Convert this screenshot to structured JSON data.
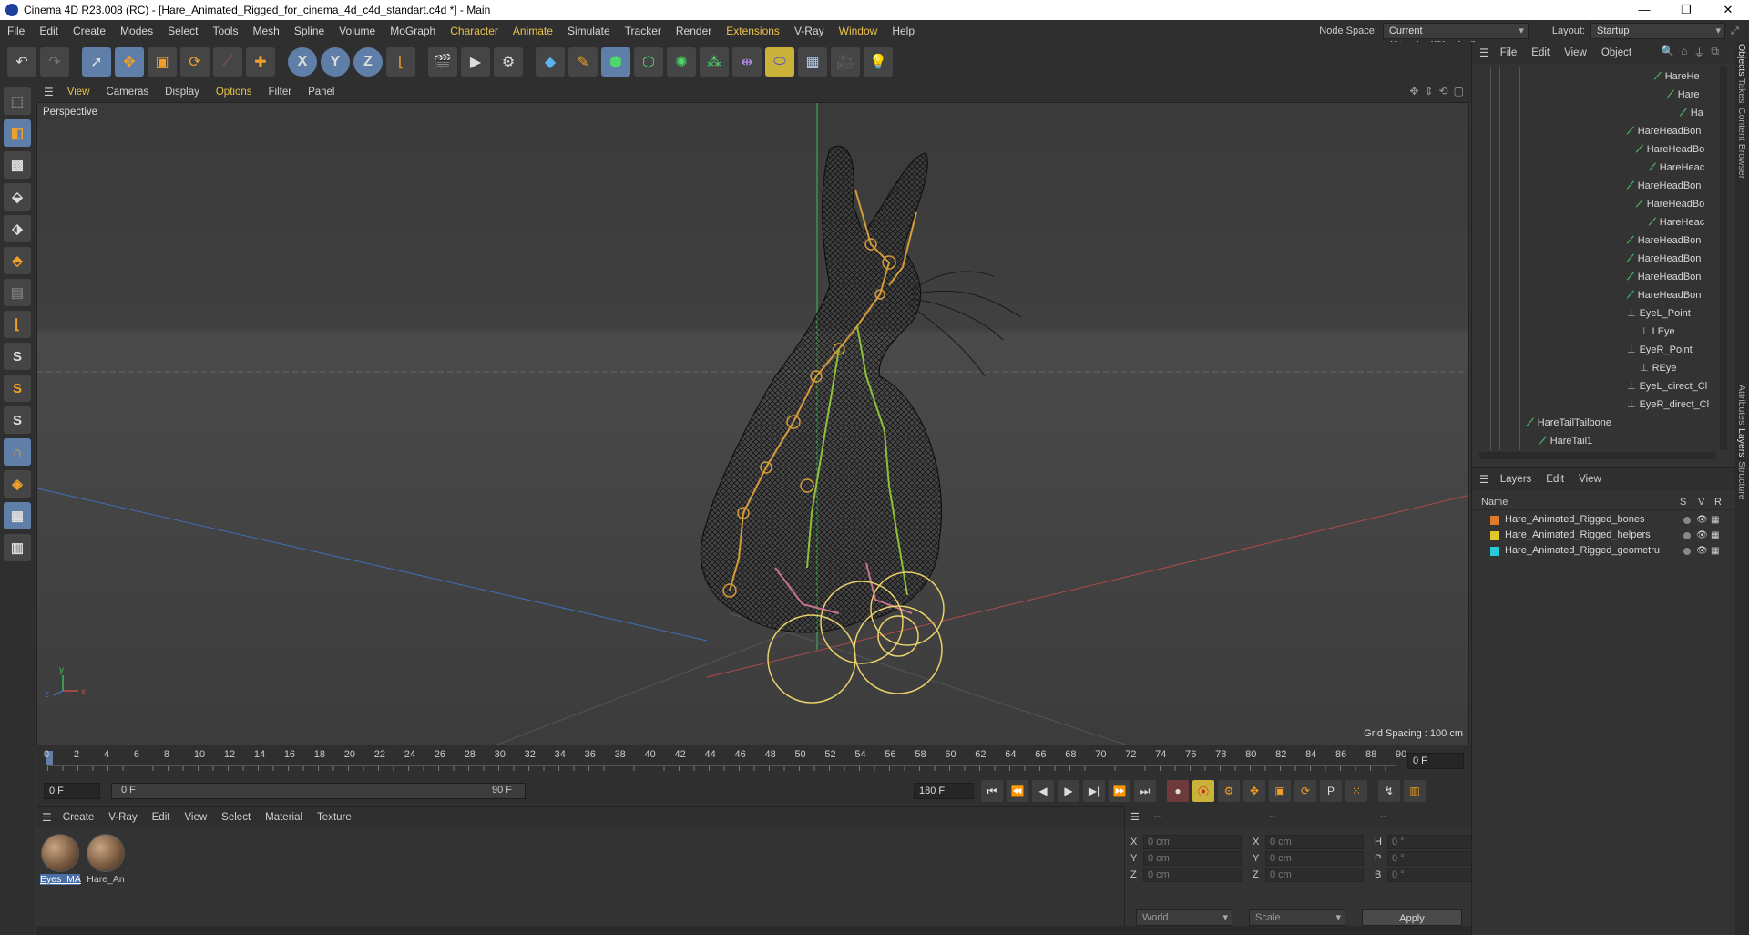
{
  "window": {
    "title": "Cinema 4D R23.008 (RC) - [Hare_Animated_Rigged_for_cinema_4d_c4d_standart.c4d *] - Main"
  },
  "menubar": {
    "items": [
      "File",
      "Edit",
      "Create",
      "Modes",
      "Select",
      "Tools",
      "Mesh",
      "Spline",
      "Volume",
      "MoGraph",
      "Character",
      "Animate",
      "Simulate",
      "Tracker",
      "Render",
      "Extensions",
      "V-Ray",
      "Window",
      "Help"
    ],
    "node_space_label": "Node Space:",
    "node_space_value": "Current (Standard/Physical)",
    "layout_label": "Layout:",
    "layout_value": "Startup"
  },
  "toolbar": {
    "icons": [
      "undo-icon",
      "redo-icon",
      "live-select-icon",
      "move-icon",
      "scale-icon",
      "rotate-icon",
      "recent-tool-icon",
      "transform-icon",
      "x-axis-icon",
      "y-axis-icon",
      "z-axis-icon",
      "coordinate-system-icon",
      "render-view-icon",
      "render-picture-viewer-icon",
      "render-settings-icon",
      "cube-icon",
      "pen-icon",
      "subdivision-icon",
      "extrude-icon",
      "cloner-icon",
      "array-icon",
      "symmetry-icon",
      "deformer-icon",
      "floor-icon",
      "camera-icon",
      "light-icon"
    ],
    "axis_labels": [
      "X",
      "Y",
      "Z"
    ]
  },
  "viewport": {
    "menu": [
      "View",
      "Cameras",
      "Display",
      "Options",
      "Filter",
      "Panel"
    ],
    "label": "Perspective",
    "grid_spacing": "Grid Spacing : 100 cm"
  },
  "timeline": {
    "ticks": [
      "0",
      "2",
      "4",
      "6",
      "8",
      "10",
      "12",
      "14",
      "16",
      "18",
      "20",
      "22",
      "24",
      "26",
      "28",
      "30",
      "32",
      "34",
      "36",
      "38",
      "40",
      "42",
      "44",
      "46",
      "48",
      "50",
      "52",
      "54",
      "56",
      "58",
      "60",
      "62",
      "64",
      "66",
      "68",
      "70",
      "72",
      "74",
      "76",
      "78",
      "80",
      "82",
      "84",
      "86",
      "88",
      "90"
    ],
    "current_frame_right": "0 F",
    "start_frame": "0 F",
    "range_start": "0 F",
    "range_end": "90 F",
    "end_frame": "180 F",
    "playhead_fraction": 0.0
  },
  "materials": {
    "menu": [
      "Create",
      "V-Ray",
      "Edit",
      "View",
      "Select",
      "Material",
      "Texture"
    ],
    "items": [
      {
        "label": "Eyes_MA",
        "selected": true
      },
      {
        "label": "Hare_An",
        "selected": false
      }
    ]
  },
  "coordinates": {
    "header": [
      "--",
      "--",
      "--"
    ],
    "rows": [
      {
        "a": "X",
        "v1": "0 cm",
        "b": "X",
        "v2": "0 cm",
        "c": "H",
        "v3": "0 °"
      },
      {
        "a": "Y",
        "v1": "0 cm",
        "b": "Y",
        "v2": "0 cm",
        "c": "P",
        "v3": "0 °"
      },
      {
        "a": "Z",
        "v1": "0 cm",
        "b": "Z",
        "v2": "0 cm",
        "c": "B",
        "v3": "0 °"
      }
    ],
    "mode": "World",
    "scale": "Scale",
    "apply": "Apply"
  },
  "objects": {
    "menu": [
      "File",
      "Edit",
      "View",
      "Object"
    ],
    "items": [
      {
        "label": "HareHe",
        "type": "bone",
        "indent": 200
      },
      {
        "label": "Hare",
        "type": "bone",
        "indent": 214
      },
      {
        "label": "Ha",
        "type": "bone",
        "indent": 228
      },
      {
        "label": "HareHeadBon",
        "type": "bone",
        "indent": 170
      },
      {
        "label": "HareHeadBo",
        "type": "bone",
        "indent": 180
      },
      {
        "label": "HareHeac",
        "type": "bone",
        "indent": 194
      },
      {
        "label": "HareHeadBon",
        "type": "bone",
        "indent": 170
      },
      {
        "label": "HareHeadBo",
        "type": "bone",
        "indent": 180
      },
      {
        "label": "HareHeac",
        "type": "bone",
        "indent": 194
      },
      {
        "label": "HareHeadBon",
        "type": "bone",
        "indent": 170
      },
      {
        "label": "HareHeadBon",
        "type": "bone",
        "indent": 170
      },
      {
        "label": "HareHeadBon",
        "type": "bone",
        "indent": 170
      },
      {
        "label": "HareHeadBon",
        "type": "bone",
        "indent": 170
      },
      {
        "label": "EyeL_Point",
        "type": "null",
        "indent": 170
      },
      {
        "label": "LEye",
        "type": "null",
        "indent": 184
      },
      {
        "label": "EyeR_Point",
        "type": "null",
        "indent": 170
      },
      {
        "label": "REye",
        "type": "null",
        "indent": 184
      },
      {
        "label": "EyeL_direct_Cl",
        "type": "null",
        "indent": 170
      },
      {
        "label": "EyeR_direct_Cl",
        "type": "null",
        "indent": 170
      },
      {
        "label": "HareTailTailbone",
        "type": "bone",
        "indent": 60
      },
      {
        "label": "HareTail1",
        "type": "bone",
        "indent": 74
      }
    ]
  },
  "layers": {
    "menu": [
      "Layers",
      "Edit",
      "View"
    ],
    "columns": [
      "Name",
      "S",
      "V",
      "R"
    ],
    "items": [
      {
        "label": "Hare_Animated_Rigged_bones",
        "color": "#e07a28"
      },
      {
        "label": "Hare_Animated_Rigged_helpers",
        "color": "#e0c828"
      },
      {
        "label": "Hare_Animated_Rigged_geometru",
        "color": "#28c8d8"
      }
    ]
  },
  "side_tabs": [
    "Objects",
    "Takes",
    "Content Browser",
    "Attributes",
    "Layers",
    "Structure"
  ]
}
